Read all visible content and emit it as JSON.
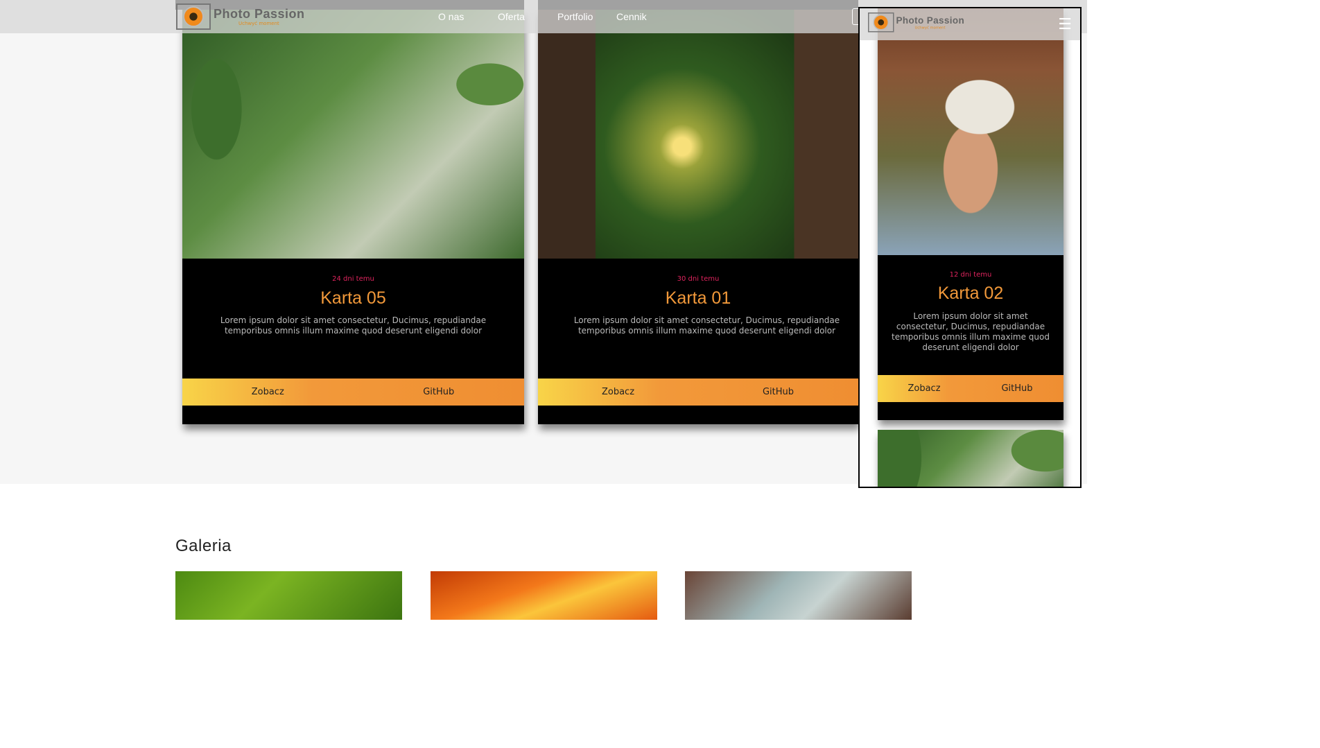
{
  "brand": {
    "name": "Photo Passion",
    "tagline": "Uchwyć moment"
  },
  "nav": [
    "O nas",
    "Oferta",
    "Portfolio",
    "Cennik"
  ],
  "cards": [
    {
      "date": "24 dni temu",
      "title": "Karta 05",
      "desc": "Lorem ipsum dolor sit amet consectetur, Ducimus, repudiandae temporibus omnis illum maxime quod deserunt eligendi dolor",
      "btn1": "Zobacz",
      "btn2": "GitHub"
    },
    {
      "date": "30 dni temu",
      "title": "Karta 01",
      "desc": "Lorem ipsum dolor sit amet consectetur, Ducimus, repudiandae temporibus omnis illum maxime quod deserunt eligendi dolor",
      "btn1": "Zobacz",
      "btn2": "GitHub"
    }
  ],
  "mobile": {
    "card": {
      "date": "12 dni temu",
      "title": "Karta 02",
      "desc": "Lorem ipsum dolor sit amet consectetur, Ducimus, repudiandae temporibus omnis illum maxime quod deserunt eligendi dolor",
      "btn1": "Zobacz",
      "btn2": "GitHub"
    },
    "menu_icon": "hamburger-icon"
  },
  "gallery": {
    "title": "Galeria"
  },
  "colors": {
    "accent": "#f2993a",
    "date": "#e0245e",
    "gradient_start": "#f8d448"
  }
}
